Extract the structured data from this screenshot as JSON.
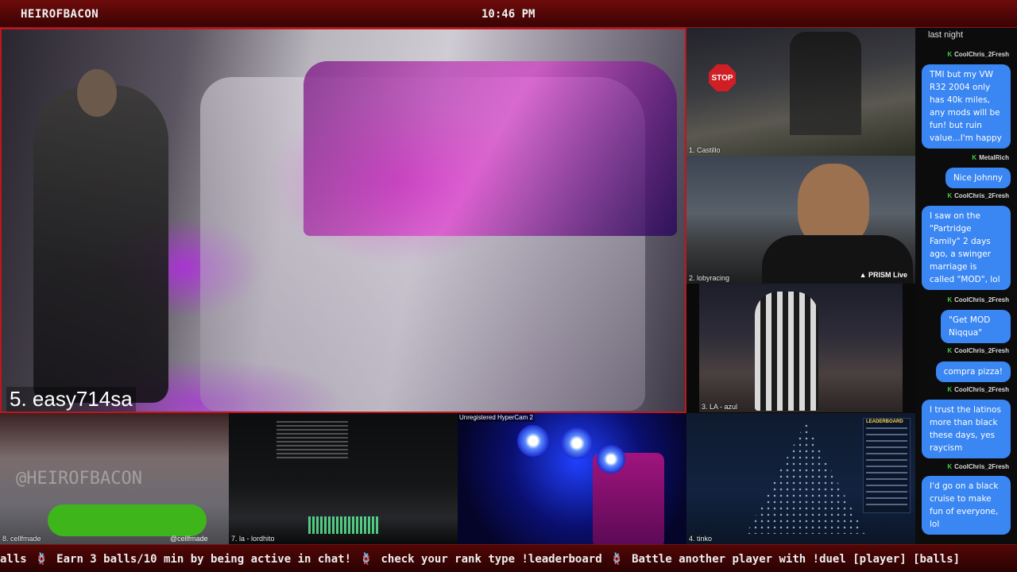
{
  "header": {
    "channel": "HEIROFBACON",
    "clock": "10:46 PM"
  },
  "main_feed": {
    "label": "5. easy714sa"
  },
  "side_feeds": [
    {
      "label": "1. Castillo",
      "sign": "STOP"
    },
    {
      "label": "2. lobyracing",
      "badge": "PRISM Live"
    },
    {
      "label": "3. LA - azul"
    }
  ],
  "bottom_feeds": [
    {
      "label": "8. cellfmade",
      "handle": "@cellfmade",
      "watermark": "@HEIROFBACON"
    },
    {
      "label": "7. la - lordhito"
    },
    {
      "label": "Unregistered HyperCam 2"
    },
    {
      "label": "4. tinko",
      "board_title": "LEADERBOARD"
    }
  ],
  "chat": {
    "top_text": "last night",
    "messages": [
      {
        "user": "CoolChris_2Fresh",
        "text": "TMI but my VW R32 2004 only has 40k miles, any mods will be fun! but ruin value...I'm happy"
      },
      {
        "user": "MetalRich",
        "text": "Nice Johnny"
      },
      {
        "user": "CoolChris_2Fresh",
        "text": "I saw on the \"Partridge Family\" 2 days ago, a swinger marriage is called \"MOD\", lol"
      },
      {
        "user": "CoolChris_2Fresh",
        "text": "\"Get MOD Niqqua\""
      },
      {
        "user": "CoolChris_2Fresh",
        "text": "compra pizza!"
      },
      {
        "user": "CoolChris_2Fresh",
        "text": "I trust the latinos more than black these days, yes raycism"
      },
      {
        "user": "CoolChris_2Fresh",
        "text": "I'd go on a black cruise to make fun of everyone, lol"
      }
    ]
  },
  "ticker": {
    "items": [
      "alls",
      "Earn 3 balls/10 min by being active in chat!",
      "check your rank type !leaderboard",
      "Battle another player with !duel [player] [balls]"
    ],
    "separator": "🪢"
  },
  "colors": {
    "accent_red": "#c0161b",
    "chat_bubble": "#3a86f2",
    "mod_badge": "#3bd13b"
  }
}
